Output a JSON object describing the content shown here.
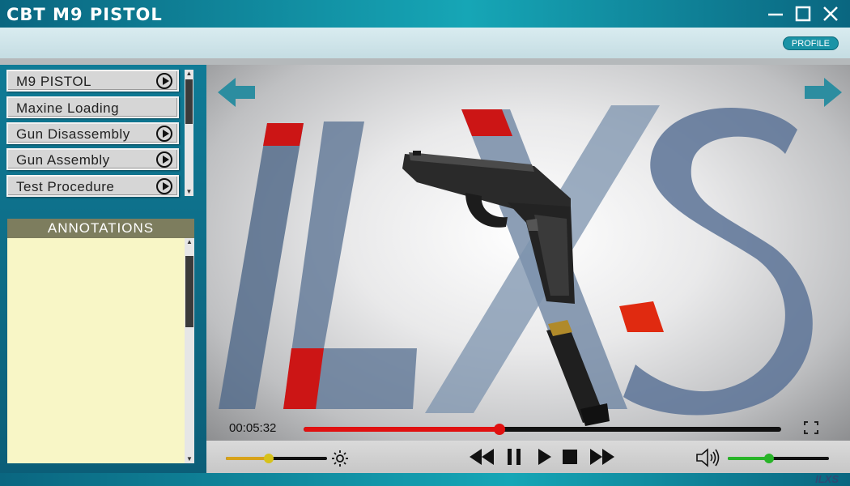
{
  "window": {
    "title": "CBT M9 PISTOL"
  },
  "profile_label": "PROFILE",
  "menu": {
    "items": [
      {
        "label": "M9 PISTOL",
        "has_play": true
      },
      {
        "label": "Maxine Loading",
        "has_play": false
      },
      {
        "label": "Gun Disassembly",
        "has_play": true
      },
      {
        "label": "Gun Assembly",
        "has_play": true
      },
      {
        "label": "Test Procedure",
        "has_play": true
      }
    ]
  },
  "annotations": {
    "header": "ANNOTATIONS",
    "text": ""
  },
  "video": {
    "watermark": "ILXS",
    "current_time": "00:05:32",
    "progress": 0.41
  },
  "controls": {
    "brightness": 0.42,
    "volume": 0.41
  },
  "brand": "ILXS",
  "colors": {
    "accent_teal": "#16a6b6",
    "progress_red": "#e01010",
    "brightness_orange": "#d7a21a",
    "volume_green": "#28b428",
    "annotation_bg": "#f8f6c6"
  },
  "icons": [
    "minimize-icon",
    "maximize-icon",
    "close-icon",
    "play-circle-icon",
    "back-arrow-icon",
    "forward-arrow-icon",
    "fullscreen-icon",
    "brightness-icon",
    "rewind-icon",
    "pause-icon",
    "play-icon",
    "stop-icon",
    "fast-forward-icon",
    "volume-icon"
  ]
}
